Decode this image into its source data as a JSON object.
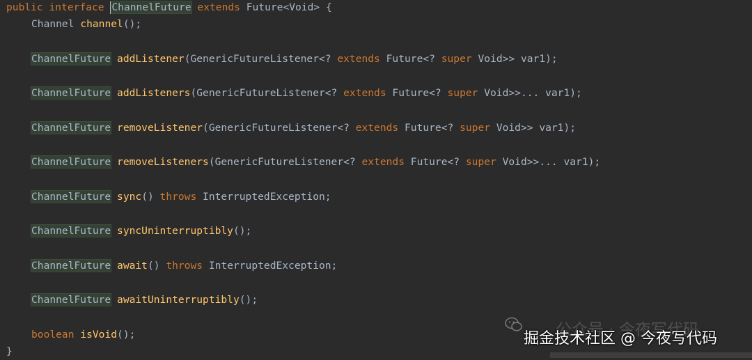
{
  "code": {
    "l1": {
      "kw1": "public",
      "kw2": "interface",
      "name": "ChannelFuture",
      "kw3": "extends",
      "rest": "Future<Void> {"
    },
    "l2": {
      "type": "Channel",
      "fn": "channel",
      "tail": "();"
    },
    "l3": {
      "type": "ChannelFuture",
      "fn": "addListener",
      "p1": "(GenericFutureListener<? ",
      "kwA": "extends",
      "p2": " Future<? ",
      "kwB": "super",
      "p3": " Void>> var1);"
    },
    "l4": {
      "type": "ChannelFuture",
      "fn": "addListeners",
      "p1": "(GenericFutureListener<? ",
      "kwA": "extends",
      "p2": " Future<? ",
      "kwB": "super",
      "p3": " Void>>... var1);"
    },
    "l5": {
      "type": "ChannelFuture",
      "fn": "removeListener",
      "p1": "(GenericFutureListener<? ",
      "kwA": "extends",
      "p2": " Future<? ",
      "kwB": "super",
      "p3": " Void>> var1);"
    },
    "l6": {
      "type": "ChannelFuture",
      "fn": "removeListeners",
      "p1": "(GenericFutureListener<? ",
      "kwA": "extends",
      "p2": " Future<? ",
      "kwB": "super",
      "p3": " Void>>... var1);"
    },
    "l7": {
      "type": "ChannelFuture",
      "fn": "sync",
      "p1": "() ",
      "kw": "throws",
      "p2": " InterruptedException;"
    },
    "l8": {
      "type": "ChannelFuture",
      "fn": "syncUninterruptibly",
      "tail": "();"
    },
    "l9": {
      "type": "ChannelFuture",
      "fn": "await",
      "p1": "() ",
      "kw": "throws",
      "p2": " InterruptedException;"
    },
    "l10": {
      "type": "ChannelFuture",
      "fn": "awaitUninterruptibly",
      "tail": "();"
    },
    "l11": {
      "type": "boolean",
      "fn": "isVoid",
      "tail": "();"
    },
    "l12": {
      "brace": "}"
    }
  },
  "watermark": {
    "back": "公众号 · 今夜写代码",
    "front": "掘金技术社区 @ 今夜写代码",
    "icon": "wechat-icon"
  },
  "colors": {
    "background": "#2b2b2b",
    "keyword": "#cc7832",
    "method": "#ffc66d",
    "text": "#a9b7c6",
    "highlight": "#344134"
  }
}
